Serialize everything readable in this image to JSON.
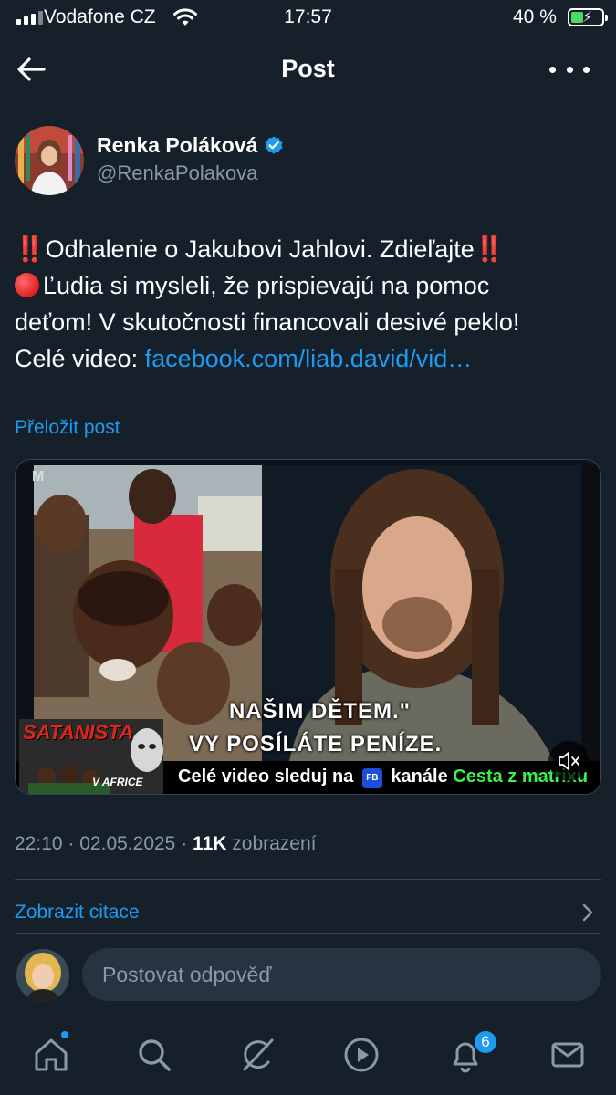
{
  "status_bar": {
    "carrier": "Vodafone CZ",
    "time": "17:57",
    "battery_percent": "40 %",
    "battery_level": 0.4
  },
  "header": {
    "title": "Post",
    "back_icon": "arrow-left-icon",
    "more_icon": "more-horizontal-icon"
  },
  "author": {
    "name": "Renka Poláková",
    "handle": "@RenkaPolakova",
    "verified_icon": "verified-badge-icon"
  },
  "post": {
    "line1_text": "Odhalenie o Jakubovi Jahlovi. Zdieľajte",
    "line2_text": "Ľudia si mysleli, že prispievajú na pomoc",
    "line3_text": "deťom! V skutočnosti financovali desivé peklo!",
    "line4_prefix": "Celé video: ",
    "link": "facebook.com/liab.david/vid…",
    "emoji_double_exclamation": "‼️",
    "emoji_red_circle": "🔴",
    "translate_label": "Přeložit post"
  },
  "media": {
    "caption_line1": "NAŠIM DĚTEM.\"",
    "caption_line2": "VY POSÍLÁTE PENÍZE.",
    "bottom_text_prefix": "Celé video sleduj na",
    "fb_badge": "FB",
    "bottom_text_mid": "kanále",
    "bottom_text_channel": "Cesta z matrixu",
    "thumb_title": "SATANISTA",
    "thumb_subtitle": "V AFRICE",
    "mute_icon": "volume-muted-icon",
    "overlay_mark": "M"
  },
  "meta": {
    "time": "22:10",
    "separator": "·",
    "date": "02.05.2025",
    "views_count": "11K",
    "views_label": "zobrazení"
  },
  "quotes": {
    "label": "Zobrazit citace",
    "chevron_icon": "chevron-right-icon"
  },
  "reply": {
    "placeholder": "Postovat odpověď"
  },
  "tabbar": {
    "items": [
      {
        "icon": "home-icon"
      },
      {
        "icon": "search-icon"
      },
      {
        "icon": "grok-icon"
      },
      {
        "icon": "play-circle-icon"
      },
      {
        "icon": "bell-icon"
      },
      {
        "icon": "mail-icon"
      }
    ],
    "notifications_badge": "6"
  },
  "colors": {
    "background": "#15202b",
    "accent": "#1d9bf0",
    "muted_text": "#8b98a5",
    "divider": "#38444d",
    "input_bg": "#273340"
  }
}
